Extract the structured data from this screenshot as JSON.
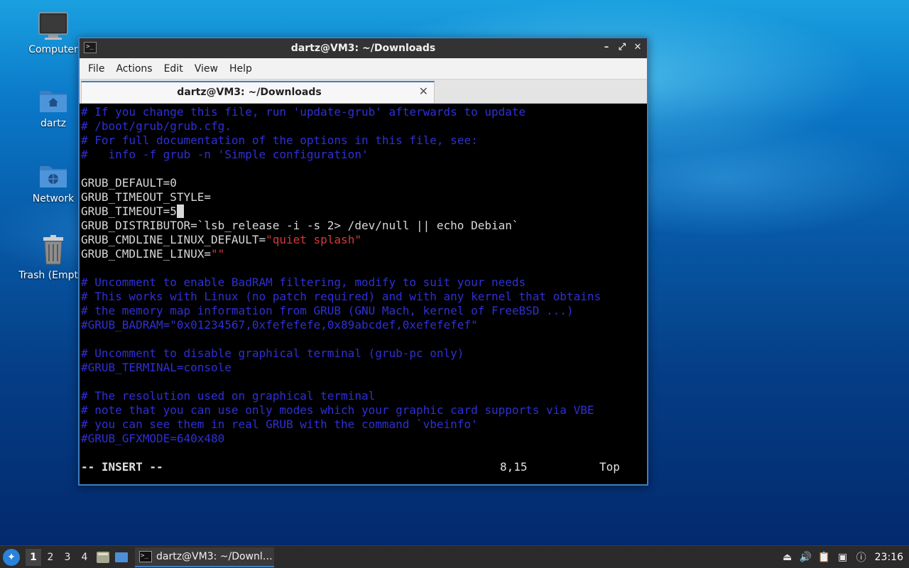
{
  "desktop": {
    "icons": [
      {
        "label": "Computer"
      },
      {
        "label": "dartz"
      },
      {
        "label": "Network"
      },
      {
        "label": "Trash (Empty)"
      }
    ]
  },
  "window": {
    "title": "dartz@VM3: ~/Downloads",
    "controls": {
      "minimize": "–",
      "maximize": "⤢",
      "close": "✕"
    },
    "menu": [
      "File",
      "Actions",
      "Edit",
      "View",
      "Help"
    ],
    "tab": {
      "title": "dartz@VM3: ~/Downloads",
      "close": "✕"
    }
  },
  "terminal": {
    "lines": [
      {
        "type": "comment",
        "text": "# If you change this file, run 'update-grub' afterwards to update"
      },
      {
        "type": "comment",
        "text": "# /boot/grub/grub.cfg."
      },
      {
        "type": "comment",
        "text": "# For full documentation of the options in this file, see:"
      },
      {
        "type": "comment",
        "text": "#   info -f grub -n 'Simple configuration'"
      },
      {
        "type": "blank",
        "text": ""
      },
      {
        "type": "normal",
        "text": "GRUB_DEFAULT=0"
      },
      {
        "type": "normal",
        "text": "GRUB_TIMEOUT_STYLE="
      },
      {
        "type": "cursor",
        "text": "GRUB_TIMEOUT=5"
      },
      {
        "type": "normal",
        "text": "GRUB_DISTRIBUTOR=`lsb_release -i -s 2> /dev/null || echo Debian`"
      },
      {
        "type": "string",
        "text": "GRUB_CMDLINE_LINUX_DEFAULT=",
        "string": "\"quiet splash\""
      },
      {
        "type": "string",
        "text": "GRUB_CMDLINE_LINUX=",
        "string": "\"\""
      },
      {
        "type": "blank",
        "text": ""
      },
      {
        "type": "comment",
        "text": "# Uncomment to enable BadRAM filtering, modify to suit your needs"
      },
      {
        "type": "comment",
        "text": "# This works with Linux (no patch required) and with any kernel that obtains"
      },
      {
        "type": "comment",
        "text": "# the memory map information from GRUB (GNU Mach, kernel of FreeBSD ...)"
      },
      {
        "type": "comment",
        "text": "#GRUB_BADRAM=\"0x01234567,0xfefefefe,0x89abcdef,0xefefefef\""
      },
      {
        "type": "blank",
        "text": ""
      },
      {
        "type": "comment",
        "text": "# Uncomment to disable graphical terminal (grub-pc only)"
      },
      {
        "type": "comment",
        "text": "#GRUB_TERMINAL=console"
      },
      {
        "type": "blank",
        "text": ""
      },
      {
        "type": "comment",
        "text": "# The resolution used on graphical terminal"
      },
      {
        "type": "comment",
        "text": "# note that you can use only modes which your graphic card supports via VBE"
      },
      {
        "type": "comment",
        "text": "# you can see them in real GRUB with the command `vbeinfo'"
      },
      {
        "type": "comment",
        "text": "#GRUB_GFXMODE=640x480"
      }
    ],
    "status": {
      "mode": "-- INSERT --",
      "position": "8,15",
      "scroll": "Top"
    }
  },
  "taskbar": {
    "workspaces": [
      "1",
      "2",
      "3",
      "4"
    ],
    "active_workspace": "1",
    "task_label": "dartz@VM3: ~/Downl…",
    "clock": "23:16"
  },
  "colors": {
    "comment": "#2f2fd6",
    "string": "#d33a3a",
    "accent": "#3d7fc1"
  }
}
